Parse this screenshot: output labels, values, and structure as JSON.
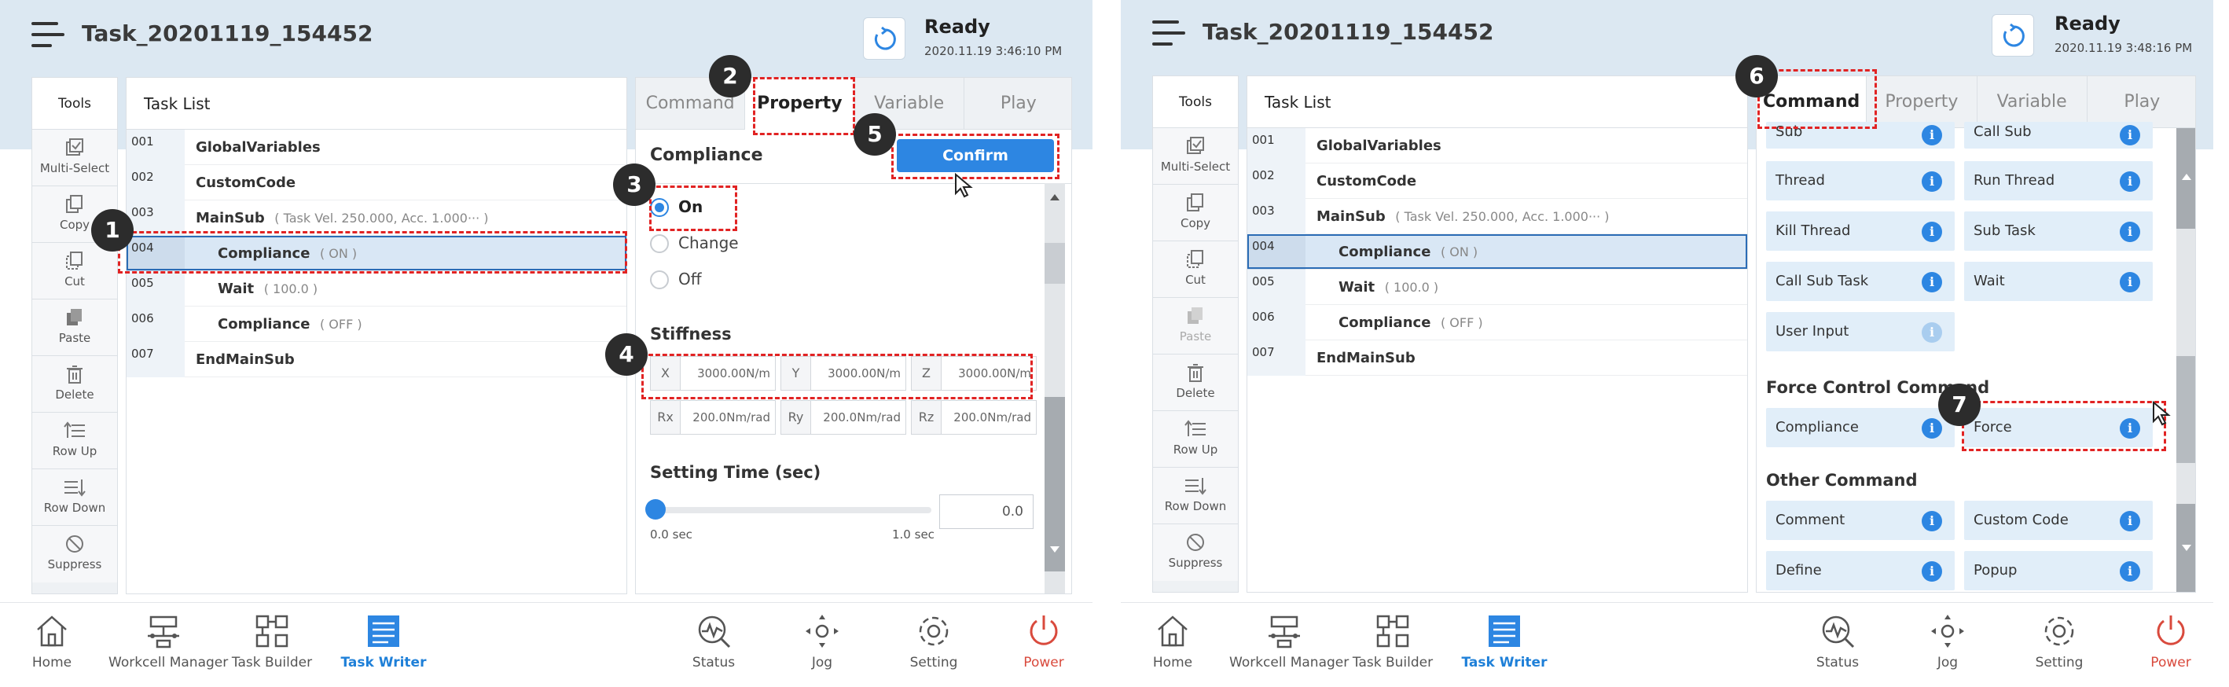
{
  "left": {
    "header": {
      "task_title": "Task_20201119_154452",
      "status": "Ready",
      "timestamp": "2020.11.19 3:46:10 PM"
    },
    "tools": {
      "title": "Tools",
      "items": [
        {
          "label": "Multi-Select",
          "icon": "multi-select-icon"
        },
        {
          "label": "Copy",
          "icon": "copy-icon"
        },
        {
          "label": "Cut",
          "icon": "cut-icon"
        },
        {
          "label": "Paste",
          "icon": "paste-icon"
        },
        {
          "label": "Delete",
          "icon": "delete-icon"
        },
        {
          "label": "Row Up",
          "icon": "row-up-icon"
        },
        {
          "label": "Row Down",
          "icon": "row-down-icon"
        },
        {
          "label": "Suppress",
          "icon": "suppress-icon"
        }
      ]
    },
    "task_list": {
      "title": "Task List",
      "rows": [
        {
          "num": "001",
          "text": "GlobalVariables",
          "param": ""
        },
        {
          "num": "002",
          "text": "CustomCode",
          "param": ""
        },
        {
          "num": "003",
          "text": "MainSub",
          "param": "( Task Vel. 250.000, Acc. 1.000··· )"
        },
        {
          "num": "004",
          "text": "Compliance",
          "param": "( ON )"
        },
        {
          "num": "005",
          "text": "Wait",
          "param": "( 100.0 )"
        },
        {
          "num": "006",
          "text": "Compliance",
          "param": "( OFF )"
        },
        {
          "num": "007",
          "text": "EndMainSub",
          "param": ""
        }
      ]
    },
    "tabs": [
      "Command",
      "Property",
      "Variable",
      "Play"
    ],
    "property": {
      "title": "Compliance",
      "confirm_label": "Confirm",
      "options": [
        "On",
        "Change",
        "Off"
      ],
      "stiffness_title": "Stiffness",
      "stiffness": [
        {
          "axis": "X",
          "value": "3000.00N/m"
        },
        {
          "axis": "Y",
          "value": "3000.00N/m"
        },
        {
          "axis": "Z",
          "value": "3000.00N/m"
        },
        {
          "axis": "Rx",
          "value": "200.0Nm/rad"
        },
        {
          "axis": "Ry",
          "value": "200.0Nm/rad"
        },
        {
          "axis": "Rz",
          "value": "200.0Nm/rad"
        }
      ],
      "setting_time_title": "Setting Time (sec)",
      "slider_min": "0.0 sec",
      "slider_max": "1.0 sec",
      "setting_time_value": "0.0"
    },
    "markers": [
      "1",
      "2",
      "3",
      "4",
      "5"
    ]
  },
  "right": {
    "header": {
      "task_title": "Task_20201119_154452",
      "status": "Ready",
      "timestamp": "2020.11.19 3:48:16 PM"
    },
    "tabs": [
      "Command",
      "Property",
      "Variable",
      "Play"
    ],
    "commands": {
      "items": [
        "Sub",
        "Call Sub",
        "Thread",
        "Run Thread",
        "Kill Thread",
        "Sub Task",
        "Call Sub Task",
        "Wait",
        "User Input"
      ],
      "force_category": "Force Control Command",
      "force_items": [
        "Compliance",
        "Force"
      ],
      "other_category": "Other Command",
      "other_items": [
        "Comment",
        "Custom Code",
        "Define",
        "Popup"
      ],
      "info_symbol": "i"
    },
    "markers": [
      "6",
      "7"
    ]
  },
  "bottom_nav": [
    "Home",
    "Workcell Manager",
    "Task Builder",
    "Task Writer",
    "Status",
    "Jog",
    "Setting",
    "Power"
  ],
  "colors": {
    "accent": "#2d86e2",
    "header_bg": "#dce8f2",
    "annotation": "#e12323",
    "power": "#d94a3d"
  }
}
